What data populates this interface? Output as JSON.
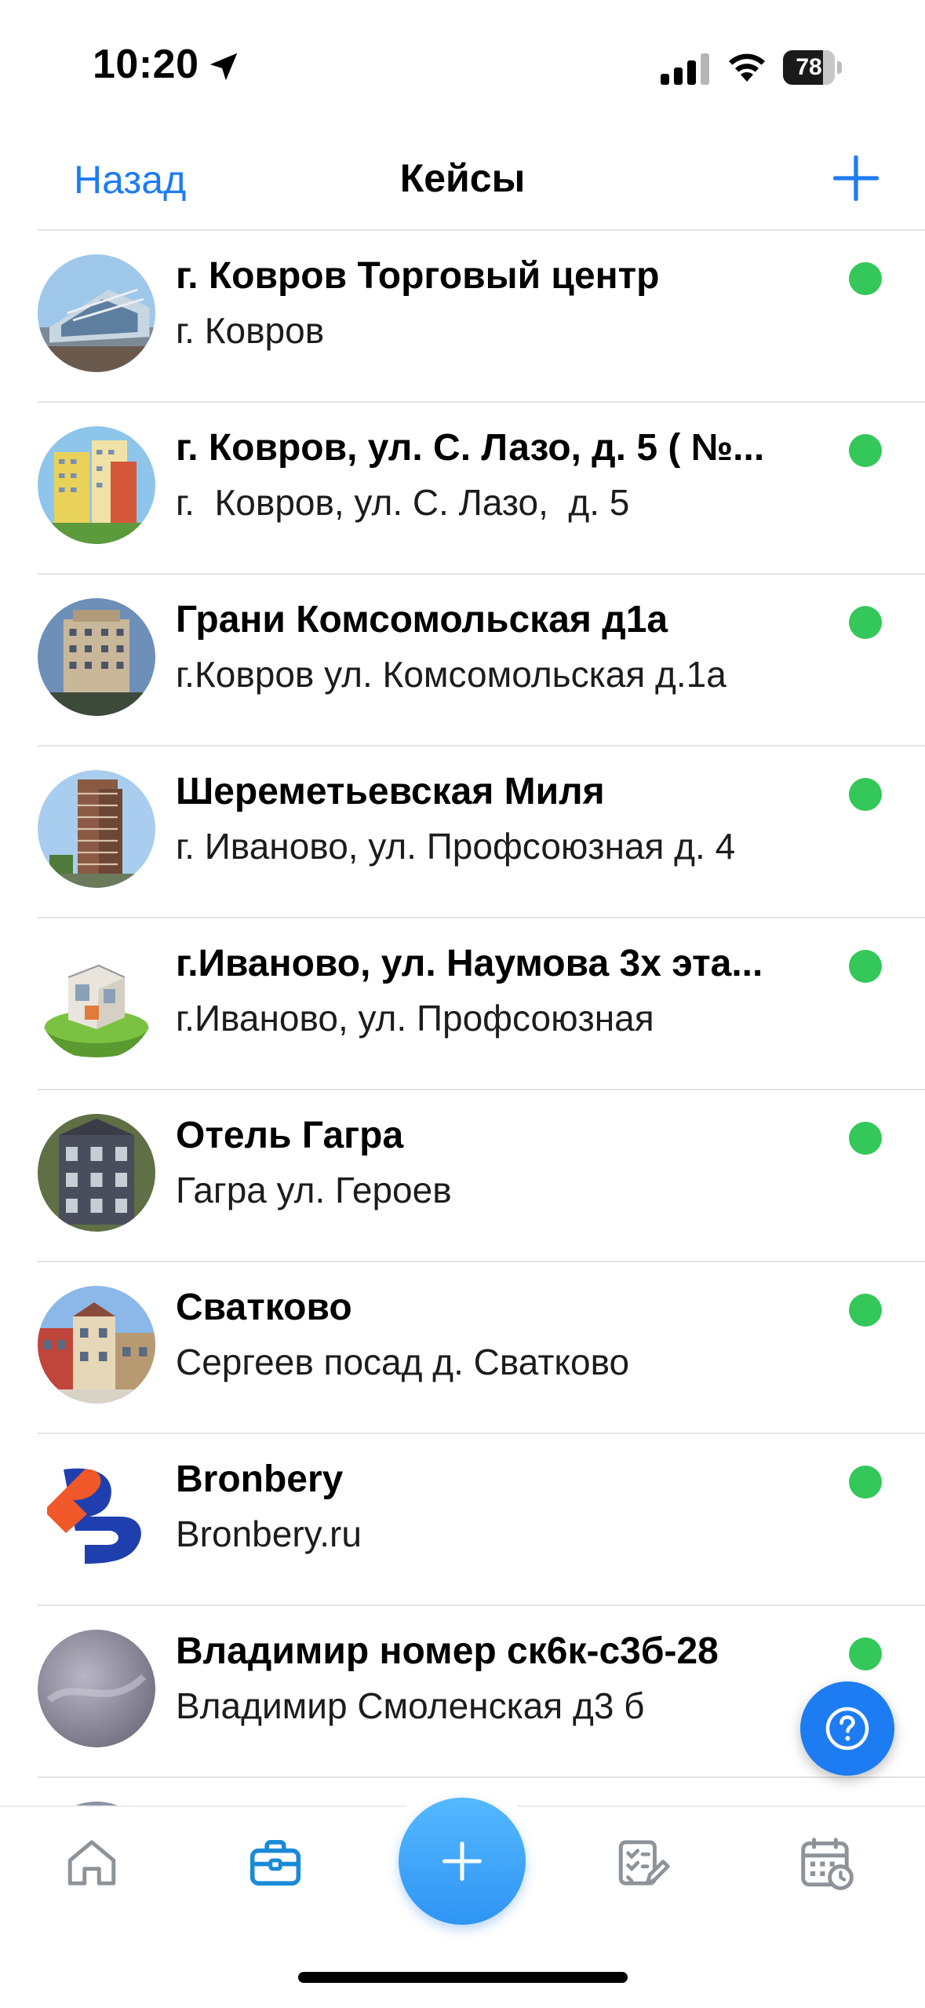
{
  "status_bar": {
    "time": "10:20",
    "battery": "78",
    "battery_level": 0.78
  },
  "nav": {
    "back_label": "Назад",
    "title": "Кейсы"
  },
  "cases": [
    {
      "title": "г. Ковров Торговый центр",
      "subtitle": "г. Ковров",
      "status": "active"
    },
    {
      "title": "г. Ковров, ул. С. Лазо, д. 5 ( №...",
      "subtitle": "г.  Ковров, ул. С. Лазо,  д. 5",
      "status": "active"
    },
    {
      "title": "Грани Комсомольская д1а",
      "subtitle": "г.Ковров ул. Комсомольская д.1а",
      "status": "active"
    },
    {
      "title": "Шереметьевская Миля",
      "subtitle": "г. Иваново, ул. Профсоюзная д. 4",
      "status": "active"
    },
    {
      "title": "г.Иваново, ул. Наумова 3х эта...",
      "subtitle": "г.Иваново, ул. Профсоюзная",
      "status": "active"
    },
    {
      "title": "Отель Гагра",
      "subtitle": "Гагра ул. Героев",
      "status": "active"
    },
    {
      "title": "Сватково",
      "subtitle": "Сергеев посад д. Сватково",
      "status": "active"
    },
    {
      "title": "Bronbery",
      "subtitle": "Bronbery.ru",
      "status": "active"
    },
    {
      "title": "Владимир номер ск6к-с3б-28",
      "subtitle": "Владимир Смоленская д3 б",
      "status": "active"
    }
  ],
  "tabs": [
    {
      "name": "home",
      "icon": "home-icon",
      "active": false
    },
    {
      "name": "cases",
      "icon": "briefcase-icon",
      "active": true
    },
    {
      "name": "add",
      "icon": "plus-icon",
      "active": false
    },
    {
      "name": "tasks",
      "icon": "checklist-icon",
      "active": false
    },
    {
      "name": "calendar",
      "icon": "calendar-clock-icon",
      "active": false
    }
  ],
  "colors": {
    "accent": "#1d7cf2",
    "status_active": "#34c759",
    "active_tab": "#1a8ad8",
    "inactive_tab": "#8e9399"
  }
}
